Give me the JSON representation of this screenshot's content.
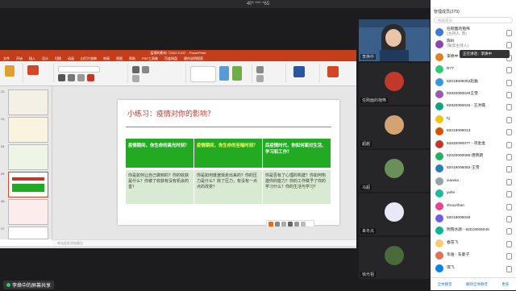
{
  "window": {
    "title": "40* *** *65"
  },
  "ppt": {
    "title": "疫情的影响（2022.3.23）- PowerPoint",
    "menu": [
      "文件",
      "开始",
      "插入",
      "设计",
      "切换",
      "动画",
      "幻灯片放映",
      "审阅",
      "视图",
      "帮助",
      "PDF工具集",
      "百度网盘",
      "操作说明搜索"
    ],
    "notes_placeholder": "单击此处添加备注",
    "thumb_numbers": [
      "22",
      "23",
      "24",
      "25",
      "26",
      "27"
    ]
  },
  "slide": {
    "title": "小练习：疫情对你的影响？",
    "header_cells": [
      "疫情期间，你生命的高光时刻？",
      "疫情期间，你生命的至暗时刻？",
      "后疫情时代，你如何面对生活、学习和工作？"
    ],
    "body_cells": [
      "你是如何让自己做到的？你的收获是什么？你被了收获有没有机会的善？",
      "你是如何度渡渐走出来的？你的压力是什么？除了压力，有没有一点点的改变？",
      "你是否有了心理的构建？你如何构建你的能力？你的工作赋予了你的学习什么？你的生活与学习？"
    ]
  },
  "videos": [
    {
      "label": "李焕中"
    },
    {
      "label": "任刚面的抱怖"
    },
    {
      "label": "超越"
    },
    {
      "label": "马超"
    },
    {
      "label": "来冬瓜"
    },
    {
      "label": "徐光祖"
    }
  ],
  "panel": {
    "title": "管理成员(279)",
    "search_placeholder": "搜索成员",
    "tooltip": "正在讲话：李焕中",
    "members": [
      {
        "name": "任刚面的抱怖",
        "sub": "(主持人, 我)",
        "color": "#3a7bd5"
      },
      {
        "name": "陈岭",
        "sub": "(联席主持人)",
        "color": "#8e44ad"
      },
      {
        "name": "李焕中",
        "sub": "",
        "color": "#e67e22"
      },
      {
        "name": "R77",
        "sub": "",
        "color": "#2ecc71"
      },
      {
        "name": "82019006052赵磊",
        "sub": "",
        "color": "#3498db"
      },
      {
        "name": "82820090049王雪",
        "sub": "",
        "color": "#9b59b6"
      },
      {
        "name": "82820090045 - 王洪霞",
        "sub": "",
        "color": "#16a085"
      },
      {
        "name": "hj",
        "sub": "",
        "color": "#f1c40f"
      },
      {
        "name": "82019006013",
        "sub": "",
        "color": "#d35400"
      },
      {
        "name": "52820090077 - 邓金金",
        "sub": "",
        "color": "#c0392b"
      },
      {
        "name": "52020090090-唐晓艳",
        "sub": "",
        "color": "#27ae60"
      },
      {
        "name": "82019006082-王雪",
        "sub": "",
        "color": "#2980b9"
      },
      {
        "name": "xiaoxia",
        "sub": "",
        "color": "#95a5a6"
      },
      {
        "name": "yefei",
        "sub": "",
        "color": "#1abc9c"
      },
      {
        "name": "zhouzihan",
        "sub": "",
        "color": "#e84393"
      },
      {
        "name": "82019006049",
        "sub": "",
        "color": "#6c5ce7"
      },
      {
        "name": "附院水颜 - 82019006046",
        "sub": "",
        "color": "#00b894"
      },
      {
        "name": "春花飞",
        "sub": "",
        "color": "#fdcb6e"
      },
      {
        "name": "华逸 - 车菱子",
        "sub": "",
        "color": "#e17055"
      },
      {
        "name": "琪飞",
        "sub": "",
        "color": "#0984e3"
      }
    ],
    "footer": [
      "全体静音",
      "解除全体静音",
      "更多"
    ]
  },
  "share_tag": "李焕中的屏幕共享",
  "colors": {
    "accent": "#c43e1c",
    "green": "#22aa22",
    "light_green": "#d9ead3"
  }
}
